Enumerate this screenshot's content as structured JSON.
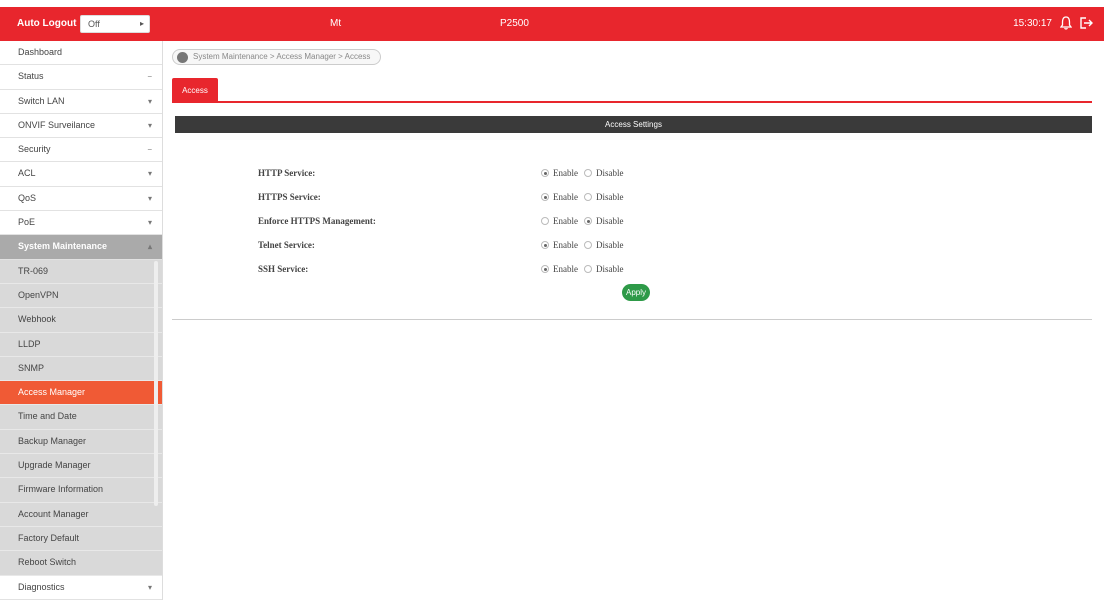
{
  "header": {
    "auto_logout_label": "Auto Logout :",
    "auto_logout_value": "Off",
    "model_left": "Mt",
    "model_right": "P2500",
    "clock": "15:30:17"
  },
  "sidebar": {
    "items": [
      {
        "label": "Dashboard",
        "chev": ""
      },
      {
        "label": "Status",
        "chev": "−"
      },
      {
        "label": "Switch LAN",
        "chev": "▾"
      },
      {
        "label": "ONVIF Surveilance",
        "chev": "▾"
      },
      {
        "label": "Security",
        "chev": "−"
      },
      {
        "label": "ACL",
        "chev": "▾"
      },
      {
        "label": "QoS",
        "chev": "▾"
      },
      {
        "label": "PoE",
        "chev": "▾"
      },
      {
        "label": "System Maintenance",
        "chev": "▴"
      }
    ],
    "sub_items": [
      "TR-069",
      "OpenVPN",
      "Webhook",
      "LLDP",
      "SNMP",
      "Access Manager",
      "Time and Date",
      "Backup Manager",
      "Upgrade Manager",
      "Firmware Information",
      "Account Manager",
      "Factory Default",
      "Reboot Switch"
    ],
    "active_sub": "Access Manager",
    "last_item": {
      "label": "Diagnostics",
      "chev": "▾"
    }
  },
  "breadcrumb": "System Maintenance > Access Manager > Access",
  "tab": "Access",
  "section_title": "Access Settings",
  "settings": [
    {
      "label": "HTTP Service:",
      "selected": "Enable"
    },
    {
      "label": "HTTPS Service:",
      "selected": "Enable"
    },
    {
      "label": "Enforce HTTPS Management:",
      "selected": "Disable"
    },
    {
      "label": "Telnet Service:",
      "selected": "Enable"
    },
    {
      "label": "SSH Service:",
      "selected": "Enable"
    }
  ],
  "options": {
    "enable": "Enable",
    "disable": "Disable"
  },
  "apply_label": "Apply",
  "colors": {
    "brand_red": "#e8262d",
    "active_orange": "#f05a35",
    "apply_green": "#2e9a48"
  }
}
